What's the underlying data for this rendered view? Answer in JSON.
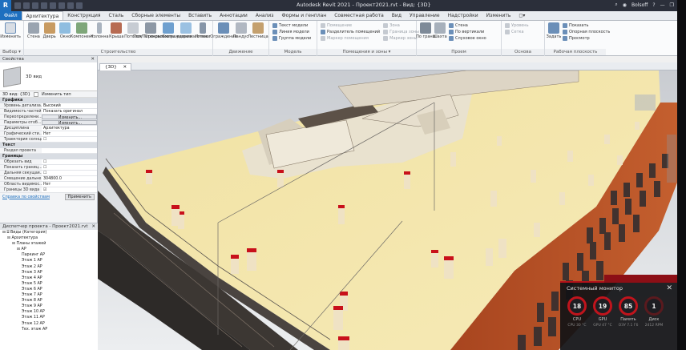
{
  "titlebar": {
    "logo": "R",
    "title": "Autodesk Revit 2021 - Проект2021.rvt - Вид: {3D}",
    "user": "Bolsoff"
  },
  "tabs": [
    "Файл",
    "Архитектура",
    "Конструкция",
    "Сталь",
    "Сборные элементы",
    "Вставить",
    "Аннотации",
    "Анализ",
    "Формы и генплан",
    "Совместная работа",
    "Вид",
    "Управление",
    "Надстройки",
    "Изменить",
    "◻▾"
  ],
  "ribbon": {
    "select": {
      "btn": "Изменить",
      "group": "Выбор ▾"
    },
    "build": {
      "buttons": [
        "Стена",
        "Дверь",
        "Окно",
        "Компонент",
        "Колонна",
        "Крыша",
        "Потолок",
        "Пол/Перекрытие",
        "Стеновое ограждение",
        "Схема разрезки стены",
        "Импост"
      ],
      "group": "Строительство"
    },
    "circulation": {
      "buttons": [
        "Ограждение",
        "Пандус",
        "Лестница"
      ],
      "group": "Движение"
    },
    "model": {
      "items": [
        "Текст модели",
        "Линия модели",
        "Группа модели"
      ],
      "group": "Модель"
    },
    "room": {
      "items": [
        "Помещение",
        "Разделитель помещений",
        "Маркер помещения",
        "Зона",
        "Граница зоны",
        "Маркер зоны"
      ],
      "group": "Помещения и зоны ▾"
    },
    "opening": {
      "buttons": [
        "По грани",
        "Шахта"
      ],
      "items": [
        "Стена",
        "По вертикали",
        "Слуховое окно"
      ],
      "group": "Проем"
    },
    "datum": {
      "items": [
        "Уровень",
        "Сетка"
      ],
      "group": "Основа"
    },
    "workplane": {
      "btn": "Задать",
      "items": [
        "Показать",
        "Опорная плоскость",
        "Просмотр"
      ],
      "group": "Рабочая плоскость"
    }
  },
  "properties": {
    "header": "Свойства",
    "type_name": "3D вид",
    "selector": "3D вид: {3D}",
    "edit_type": "Изменить тип",
    "sections": [
      {
        "name": "Графика",
        "rows": [
          [
            "Уровень детализа...",
            "Высокий",
            false
          ],
          [
            "Видимость частей",
            "Показать оригинал",
            false
          ],
          [
            "Переопределени...",
            "Изменить...",
            true
          ],
          [
            "Параметры отоб...",
            "Изменить...",
            true
          ],
          [
            "Дисциплина",
            "Архитектура",
            false
          ],
          [
            "Графический сти...",
            "Нет",
            false
          ],
          [
            "Траектория солнца",
            "☐",
            false
          ]
        ]
      },
      {
        "name": "Текст",
        "rows": [
          [
            "Раздел проекта",
            "",
            false
          ]
        ]
      },
      {
        "name": "Границы",
        "rows": [
          [
            "Обрезать вид",
            "☐",
            false
          ],
          [
            "Показать границ...",
            "☐",
            false
          ],
          [
            "Дальняя секущая...",
            "☐",
            false
          ],
          [
            "Смещение дальне...",
            "304800.0",
            false
          ],
          [
            "Область видимос...",
            "Нет",
            false
          ],
          [
            "Границы 3D вида",
            "☑",
            false
          ]
        ]
      }
    ],
    "help_link": "Справка по свойствам",
    "apply": "Применить"
  },
  "browser": {
    "header": "Диспетчер проекта - Проект2021.rvt",
    "items": [
      [
        "⊟ ⌸ Виды (Категория)",
        0
      ],
      [
        "⊟ Архитектура",
        1
      ],
      [
        "⊟ Планы этажей",
        2
      ],
      [
        "⊟ АР",
        3
      ],
      [
        "Паркинг АР",
        4
      ],
      [
        "Этаж 1 АР",
        4
      ],
      [
        "Этаж 2 АР",
        4
      ],
      [
        "Этаж 3 АР",
        4
      ],
      [
        "Этаж 4 АР",
        4
      ],
      [
        "Этаж 5 АР",
        4
      ],
      [
        "Этаж 6 АР",
        4
      ],
      [
        "Этаж 7 АР",
        4
      ],
      [
        "Этаж 8 АР",
        4
      ],
      [
        "Этаж 9 АР",
        4
      ],
      [
        "Этаж 10 АР",
        4
      ],
      [
        "Этаж 11 АР",
        4
      ],
      [
        "Этаж 12 АР",
        4
      ],
      [
        "Тех. этаж АР",
        4
      ]
    ]
  },
  "view": {
    "tab": "{3D}"
  },
  "sysmon": {
    "title": "Системный монитор",
    "close": "✕",
    "gauges": [
      {
        "value": "18",
        "label": "CPU",
        "sub": "CPU 30 °C"
      },
      {
        "value": "19",
        "label": "GPU",
        "sub": "GPU 47 °C"
      },
      {
        "value": "85",
        "label": "Память",
        "sub": "ОЗУ 7.1 Гб"
      },
      {
        "value": "1",
        "label": "Диск",
        "sub": "2412 RPM"
      }
    ]
  }
}
